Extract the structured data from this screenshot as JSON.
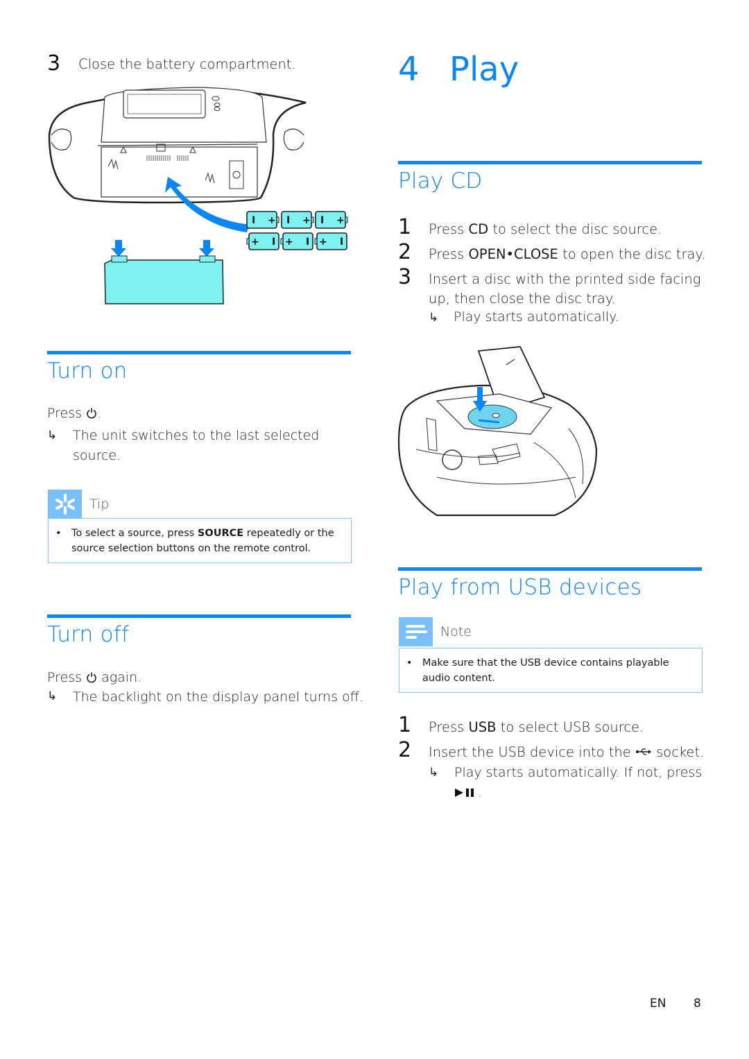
{
  "left_column": {
    "battery_step": {
      "number": "3",
      "text": "Close the battery compartment."
    },
    "battery_illustration": {
      "battery_labels": {
        "plus": "+",
        "minus": "I"
      }
    },
    "turn_on": {
      "heading": "Turn on",
      "press_prefix": "Press",
      "press_suffix": ".",
      "result_arrow": "↳",
      "result_text": "The unit switches to the last selected source."
    },
    "tip": {
      "label": "Tip",
      "bullet": "•",
      "text_before": "To select a source, press ",
      "text_bold": "SOURCE",
      "text_after": " repeatedly or the source selection buttons on the remote control."
    },
    "turn_off": {
      "heading": "Turn off",
      "press_prefix": "Press",
      "press_suffix": " again.",
      "result_arrow": "↳",
      "result_text": "The backlight on the display panel turns off."
    }
  },
  "right_column": {
    "chapter": {
      "number": "4",
      "title": "Play"
    },
    "play_cd": {
      "heading": "Play CD",
      "steps": [
        {
          "number": "1",
          "before": "Press ",
          "bold": "CD",
          "after": " to select the disc source."
        },
        {
          "number": "2",
          "before": "Press ",
          "bold": "OPEN•CLOSE",
          "after": " to open the disc tray."
        },
        {
          "number": "3",
          "before": "Insert a disc with the printed side facing up, then close the disc tray.",
          "bold": "",
          "after": ""
        }
      ],
      "result_arrow": "↳",
      "result_text": "Play starts automatically."
    },
    "play_usb": {
      "heading": "Play from USB devices",
      "note": {
        "label": "Note",
        "bullet": "•",
        "text": "Make sure that the USB device contains playable audio content."
      },
      "steps": [
        {
          "number": "1",
          "before": "Press ",
          "bold": "USB",
          "after": " to select USB source."
        },
        {
          "number": "2",
          "before": "Insert the USB device into the ",
          "bold": "",
          "after": " socket."
        }
      ],
      "result_arrow": "↳",
      "result_text": "Play starts automatically. If not, press",
      "result_suffix": "."
    }
  },
  "footer": {
    "language": "EN",
    "page_number": "8"
  },
  "colors": {
    "accent": "#0a86f5",
    "callout_icon_bg": "#79c0fb",
    "callout_border": "#86c9f7",
    "battery_fill": "#7ef2f0",
    "disc_fill": "#6fd5ee"
  }
}
